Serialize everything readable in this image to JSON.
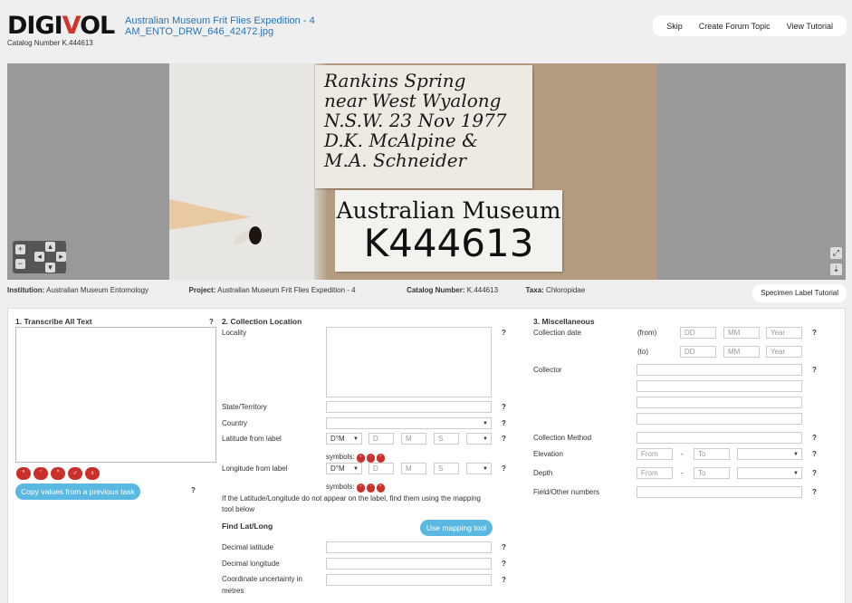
{
  "header": {
    "logo_prefix": "DIGI",
    "logo_v": "V",
    "logo_suffix": "OL",
    "catalog_line": "Catalog Number K.444613",
    "title_line1": "Australian Museum Frit Flies Expedition - 4",
    "title_line2": "AM_ENTO_DRW_646_42472.jpg",
    "skip_label": "Skip",
    "forum_label": "Create Forum Topic",
    "tutorial_label": "View Tutorial"
  },
  "image": {
    "handwritten_label": [
      "Rankins Spring",
      "near West Wyalong",
      "N.S.W. 23 Nov 1977",
      "D.K. McAlpine &",
      "M.A. Schneider"
    ],
    "printed_label_line1": "Australian Museum",
    "printed_label_line2": "K444613"
  },
  "info": {
    "institution_key": "Institution:",
    "institution_val": "Australian Museum Entomology",
    "project_key": "Project:",
    "project_val": "Australian Museum Frit Flies Expedition - 4",
    "catalog_key": "Catalog Number:",
    "catalog_val": "K.444613",
    "taxa_key": "Taxa:",
    "taxa_val": "Chloropidae",
    "specimen_tutorial": "Specimen Label Tutorial"
  },
  "section1": {
    "heading": "1. Transcribe All Text",
    "help": "?",
    "symbols": [
      "°",
      "'",
      "\"",
      "♂",
      "♀"
    ],
    "copy_button": "Copy values from a previous task"
  },
  "section2": {
    "heading": "2. Collection Location",
    "locality": "Locality",
    "state": "State/Territory",
    "country": "Country",
    "lat_label": "Latitude from label",
    "long_label": "Longitude from label",
    "deg_select": "D°M",
    "d_ph": "D",
    "m_ph": "M",
    "s_ph": "S",
    "symbols_label": "symbols:",
    "mini_symbols": [
      "°",
      "'",
      "\""
    ],
    "hint": "If the Latitude/Longitude do not appear on the label, find them using the mapping tool below",
    "find_heading": "Find Lat/Long",
    "mapping_button": "Use mapping tool",
    "dec_lat": "Decimal latitude",
    "dec_long": "Decimal longitude",
    "uncert_line1": "Coordinate uncertainty in",
    "uncert_line2": "metres"
  },
  "section3": {
    "heading": "3. Miscellaneous",
    "collection_date": "Collection date",
    "from_label": "(from)",
    "to_label": "(to)",
    "dd": "DD",
    "mm": "MM",
    "year": "Year",
    "collector": "Collector",
    "method": "Collection Method",
    "elevation": "Elevation",
    "depth": "Depth",
    "field_numbers": "Field/Other numbers",
    "from_ph": "From",
    "to_ph": "To",
    "dash": "-"
  },
  "colors": {
    "accent_blue": "#5bb8e0",
    "link_blue": "#2a74b5",
    "symbol_red": "#c9302c"
  }
}
